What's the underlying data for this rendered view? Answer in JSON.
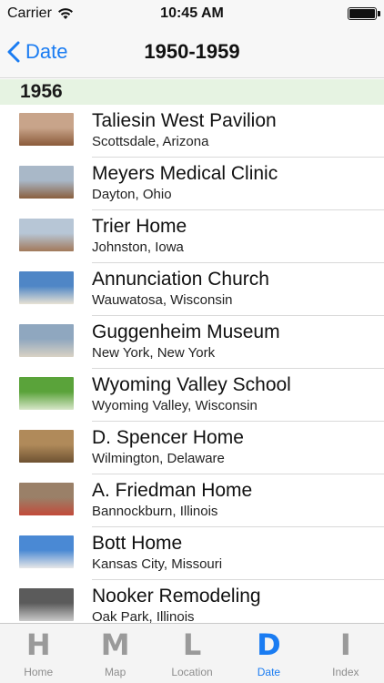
{
  "status_bar": {
    "carrier": "Carrier",
    "time": "10:45 AM",
    "wifi_icon": "wifi-icon",
    "battery_level": 1.0
  },
  "nav": {
    "back_label": "Date",
    "title": "1950-1959"
  },
  "section": {
    "year": "1956"
  },
  "items": [
    {
      "title": "Taliesin West Pavilion",
      "location": "Scottsdale, Arizona",
      "thumb_colors": [
        "#c8a48a",
        "#8a5a3a"
      ]
    },
    {
      "title": "Meyers Medical Clinic",
      "location": "Dayton, Ohio",
      "thumb_colors": [
        "#a9b8c8",
        "#8a5f3d"
      ]
    },
    {
      "title": "Trier Home",
      "location": "Johnston, Iowa",
      "thumb_colors": [
        "#b7c6d6",
        "#a2795a"
      ]
    },
    {
      "title": "Annunciation Church",
      "location": "Wauwatosa, Wisconsin",
      "thumb_colors": [
        "#4f86c6",
        "#e8e2d4"
      ]
    },
    {
      "title": "Guggenheim Museum",
      "location": "New York, New York",
      "thumb_colors": [
        "#8fa7bf",
        "#d9d2c4"
      ]
    },
    {
      "title": "Wyoming Valley School",
      "location": "Wyoming Valley, Wisconsin",
      "thumb_colors": [
        "#5aa33a",
        "#d7e6c8"
      ]
    },
    {
      "title": "D. Spencer Home",
      "location": "Wilmington, Delaware",
      "thumb_colors": [
        "#b08a5a",
        "#6e5232"
      ]
    },
    {
      "title": "A. Friedman Home",
      "location": "Bannockburn, Illinois",
      "thumb_colors": [
        "#9a8068",
        "#c24a3a"
      ]
    },
    {
      "title": "Bott Home",
      "location": "Kansas City, Missouri",
      "thumb_colors": [
        "#4a89d4",
        "#e7e7e7"
      ]
    },
    {
      "title": "Nooker Remodeling",
      "location": "Oak Park, Illinois",
      "thumb_colors": [
        "#5b5b5b",
        "#c9c9c9"
      ]
    }
  ],
  "tabs": [
    {
      "letter": "H",
      "label": "Home",
      "active": false
    },
    {
      "letter": "M",
      "label": "Map",
      "active": false
    },
    {
      "letter": "L",
      "label": "Location",
      "active": false
    },
    {
      "letter": "D",
      "label": "Date",
      "active": true
    },
    {
      "letter": "I",
      "label": "Index",
      "active": false
    }
  ],
  "colors": {
    "accent": "#1a7cf2",
    "section_bg": "#e6f3e2",
    "tab_inactive": "#9a9a9a"
  }
}
